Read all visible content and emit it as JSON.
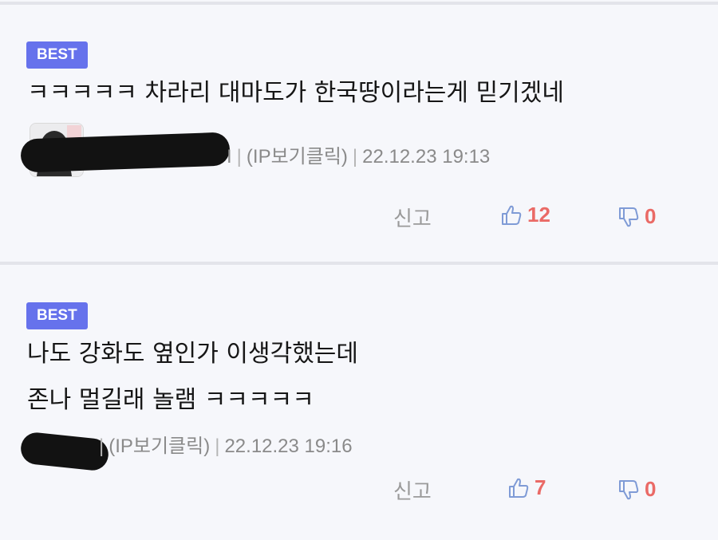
{
  "comments": [
    {
      "badge": "BEST",
      "text_lines": [
        "ㅋㅋㅋㅋㅋ 차라리 대마도가 한국땅이라는게 믿기겠네"
      ],
      "author_tail": "I",
      "ip_label": "(IP보기클릭)",
      "datetime": "22.12.23 19:13",
      "report_label": "신고",
      "likes": "12",
      "dislikes": "0"
    },
    {
      "badge": "BEST",
      "text_lines": [
        "나도 강화도 옆인가 이생각했는데",
        "존나 멀길래 놀램 ㅋㅋㅋㅋㅋ"
      ],
      "author_tail": "",
      "ip_label": "(IP보기클릭)",
      "datetime": "22.12.23 19:16",
      "report_label": "신고",
      "likes": "7",
      "dislikes": "0"
    }
  ],
  "icons": {
    "like": "thumbs-up-icon",
    "dislike": "thumbs-down-icon"
  },
  "colors": {
    "badge": "#6672ec",
    "vote_count": "#ea6a66",
    "vote_icon": "#7f9bd6"
  }
}
